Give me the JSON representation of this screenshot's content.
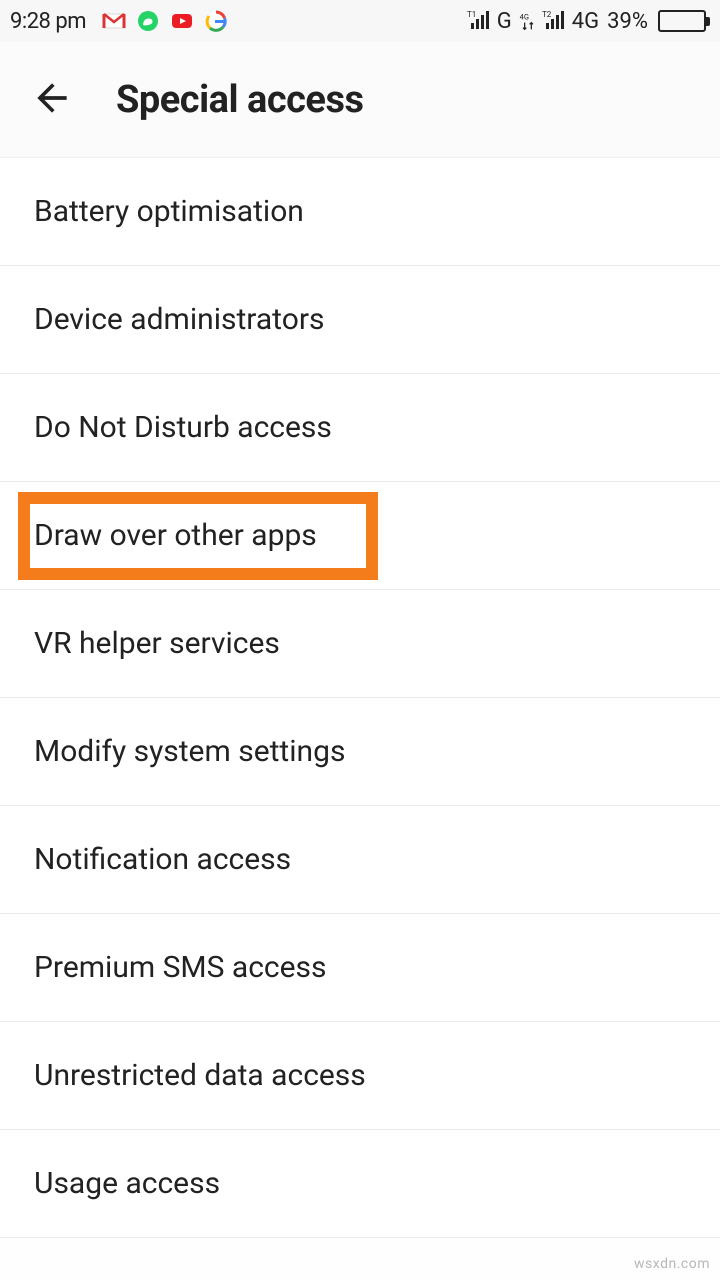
{
  "status_bar": {
    "time": "9:28 pm",
    "network1_label": "G",
    "network2_data": "4G",
    "network2_label": "4G",
    "battery_percent": "39%"
  },
  "header": {
    "title": "Special access"
  },
  "list": {
    "items": [
      {
        "label": "Battery optimisation",
        "highlighted": false
      },
      {
        "label": "Device administrators",
        "highlighted": false
      },
      {
        "label": "Do Not Disturb access",
        "highlighted": false
      },
      {
        "label": "Draw over other apps",
        "highlighted": true
      },
      {
        "label": "VR helper services",
        "highlighted": false
      },
      {
        "label": "Modify system settings",
        "highlighted": false
      },
      {
        "label": "Notification access",
        "highlighted": false
      },
      {
        "label": "Premium SMS access",
        "highlighted": false
      },
      {
        "label": "Unrestricted data access",
        "highlighted": false
      },
      {
        "label": "Usage access",
        "highlighted": false
      }
    ]
  },
  "watermark": "wsxdn.com"
}
